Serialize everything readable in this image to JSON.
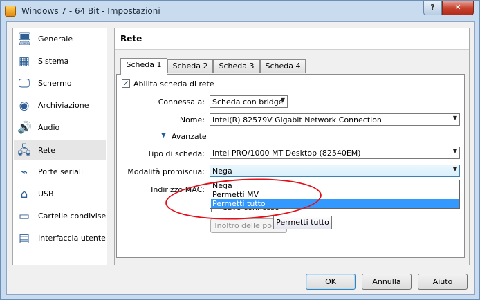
{
  "window": {
    "title": "Windows 7 - 64 Bit - Impostazioni",
    "help_glyph": "?",
    "close_glyph": "✕"
  },
  "sidebar": {
    "items": [
      {
        "label": "Generale",
        "icon": "monitor-icon",
        "glyph": "🖥"
      },
      {
        "label": "Sistema",
        "icon": "chip-icon",
        "glyph": "▦"
      },
      {
        "label": "Schermo",
        "icon": "display-icon",
        "glyph": "🖵"
      },
      {
        "label": "Archiviazione",
        "icon": "disk-icon",
        "glyph": "◉"
      },
      {
        "label": "Audio",
        "icon": "speaker-icon",
        "glyph": "🔊"
      },
      {
        "label": "Rete",
        "icon": "network-icon",
        "glyph": "🖧"
      },
      {
        "label": "Porte seriali",
        "icon": "serial-port-icon",
        "glyph": "⌁"
      },
      {
        "label": "USB",
        "icon": "usb-icon",
        "glyph": "⌂"
      },
      {
        "label": "Cartelle condivise",
        "icon": "folder-icon",
        "glyph": "▭"
      },
      {
        "label": "Interfaccia utente",
        "icon": "ui-window-icon",
        "glyph": "▤"
      }
    ],
    "selected": "Rete"
  },
  "page": {
    "title": "Rete"
  },
  "tabs": [
    {
      "label": "Scheda 1",
      "active": true
    },
    {
      "label": "Scheda 2",
      "active": false
    },
    {
      "label": "Scheda 3",
      "active": false
    },
    {
      "label": "Scheda 4",
      "active": false
    }
  ],
  "form": {
    "enable_label": "Abilita scheda di rete",
    "enable_checked": true,
    "attached_label": "Connessa a:",
    "attached_value": "Scheda con bridge",
    "name_label": "Nome:",
    "name_value": "Intel(R) 82579V Gigabit Network Connection",
    "advanced_label": "Avanzate",
    "adapter_type_label": "Tipo di scheda:",
    "adapter_type_value": "Intel PRO/1000 MT Desktop (82540EM)",
    "promisc_label": "Modalità promiscua:",
    "promisc_value": "Nega",
    "mac_label": "Indirizzo MAC:",
    "cable_label": "Cavo connesso",
    "cable_checked": true,
    "port_forward_label": "Inoltro delle porte"
  },
  "dropdown": {
    "options": [
      "Nega",
      "Permetti MV",
      "Permetti tutto"
    ],
    "highlighted": "Permetti tutto"
  },
  "tooltip": {
    "text": "Permetti tutto"
  },
  "dialog_buttons": {
    "ok": "OK",
    "cancel": "Annulla",
    "help": "Aiuto"
  },
  "colors": {
    "highlight": "#3399ff",
    "annotation": "#e3101a"
  }
}
